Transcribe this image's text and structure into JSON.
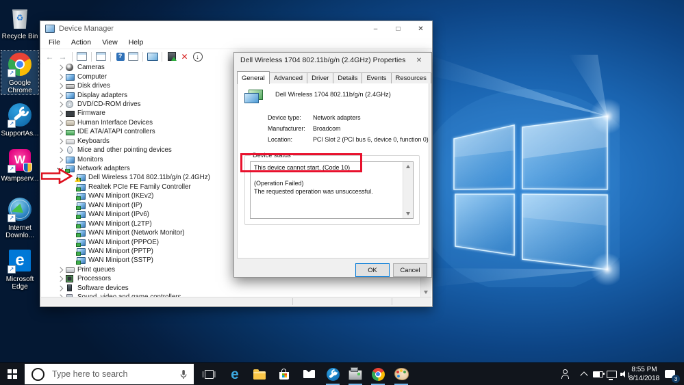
{
  "desktop": {
    "icons": [
      {
        "name": "recycle-bin",
        "lines": [
          "Recycle Bin"
        ]
      },
      {
        "name": "google-chrome",
        "lines": [
          "Google",
          "Chrome"
        ],
        "selected": true
      },
      {
        "name": "supportassist",
        "lines": [
          "SupportAs..."
        ]
      },
      {
        "name": "wampserver",
        "lines": [
          "Wampserv..."
        ]
      },
      {
        "name": "internet-download-manager",
        "lines": [
          "Internet",
          "Downlo..."
        ]
      },
      {
        "name": "microsoft-edge",
        "lines": [
          "Microsoft",
          "Edge"
        ]
      }
    ]
  },
  "device_manager": {
    "title": "Device Manager",
    "window_buttons": {
      "minimize": "–",
      "maximize": "□",
      "close": "✕"
    },
    "menu_items": [
      "File",
      "Action",
      "View",
      "Help"
    ],
    "toolbar": [
      "back",
      "forward",
      "sep",
      "console-tree",
      "sep",
      "properties",
      "sep",
      "help",
      "action-pane",
      "sep",
      "scan-hardware",
      "sep",
      "update-driver",
      "uninstall-device",
      "disable-device"
    ],
    "tree": [
      {
        "label": "Cameras",
        "icon": "camera",
        "expand": "collapsed"
      },
      {
        "label": "Computer",
        "icon": "computer",
        "expand": "collapsed"
      },
      {
        "label": "Disk drives",
        "icon": "disk",
        "expand": "collapsed"
      },
      {
        "label": "Display adapters",
        "icon": "display",
        "expand": "collapsed"
      },
      {
        "label": "DVD/CD-ROM drives",
        "icon": "dvd",
        "expand": "collapsed"
      },
      {
        "label": "Firmware",
        "icon": "firmware",
        "expand": "collapsed"
      },
      {
        "label": "Human Interface Devices",
        "icon": "hid",
        "expand": "collapsed"
      },
      {
        "label": "IDE ATA/ATAPI controllers",
        "icon": "ide",
        "expand": "collapsed"
      },
      {
        "label": "Keyboards",
        "icon": "keyboard",
        "expand": "collapsed"
      },
      {
        "label": "Mice and other pointing devices",
        "icon": "mouse",
        "expand": "collapsed"
      },
      {
        "label": "Monitors",
        "icon": "monitor",
        "expand": "collapsed"
      },
      {
        "label": "Network adapters",
        "icon": "network",
        "expand": "expanded"
      },
      {
        "label": "Dell Wireless 1704 802.11b/g/n (2.4GHz)",
        "icon": "network",
        "child": true,
        "warning": true
      },
      {
        "label": "Realtek PCIe FE Family Controller",
        "icon": "network",
        "child": true
      },
      {
        "label": "WAN Miniport (IKEv2)",
        "icon": "network",
        "child": true
      },
      {
        "label": "WAN Miniport (IP)",
        "icon": "network",
        "child": true
      },
      {
        "label": "WAN Miniport (IPv6)",
        "icon": "network",
        "child": true
      },
      {
        "label": "WAN Miniport (L2TP)",
        "icon": "network",
        "child": true
      },
      {
        "label": "WAN Miniport (Network Monitor)",
        "icon": "network",
        "child": true
      },
      {
        "label": "WAN Miniport (PPPOE)",
        "icon": "network",
        "child": true
      },
      {
        "label": "WAN Miniport (PPTP)",
        "icon": "network",
        "child": true
      },
      {
        "label": "WAN Miniport (SSTP)",
        "icon": "network",
        "child": true
      },
      {
        "label": "Print queues",
        "icon": "printer",
        "expand": "collapsed"
      },
      {
        "label": "Processors",
        "icon": "processor",
        "expand": "collapsed"
      },
      {
        "label": "Software devices",
        "icon": "software",
        "expand": "collapsed"
      },
      {
        "label": "Sound, video and game controllers",
        "icon": "sound",
        "expand": "collapsed"
      }
    ]
  },
  "properties_dialog": {
    "title": "Dell Wireless 1704 802.11b/g/n (2.4GHz) Properties",
    "close_glyph": "✕",
    "tabs": [
      {
        "label": "General",
        "active": true
      },
      {
        "label": "Advanced"
      },
      {
        "label": "Driver"
      },
      {
        "label": "Details"
      },
      {
        "label": "Events"
      },
      {
        "label": "Resources"
      }
    ],
    "device_name": "Dell Wireless 1704 802.11b/g/n (2.4GHz)",
    "fields": [
      {
        "label": "Device type:",
        "value": "Network adapters"
      },
      {
        "label": "Manufacturer:",
        "value": "Broadcom"
      },
      {
        "label": "Location:",
        "value": "PCI Slot 2 (PCI bus 6, device 0, function 0)"
      }
    ],
    "group_label": "Device status",
    "status_lines": [
      "This device cannot start. (Code 10)",
      "",
      "(Operation Failed)",
      "The requested operation was unsuccessful."
    ],
    "buttons": {
      "ok": "OK",
      "cancel": "Cancel"
    }
  },
  "taskbar": {
    "search_placeholder": "Type here to search",
    "apps": [
      {
        "name": "task-view"
      },
      {
        "name": "edge"
      },
      {
        "name": "file-explorer"
      },
      {
        "name": "store"
      },
      {
        "name": "mail"
      },
      {
        "name": "supportassist",
        "running": true
      },
      {
        "name": "device-manager",
        "running": true
      },
      {
        "name": "chrome",
        "running": true
      },
      {
        "name": "paint",
        "running": true
      }
    ],
    "tray": {
      "icons": [
        "people-icon",
        "chevron-up-icon",
        "battery-icon",
        "network-icon",
        "volume-icon"
      ],
      "time": "8:55 PM",
      "date": "8/14/2018",
      "notification_count": "3"
    }
  },
  "annotations": {
    "highlight_color": "#e8112d"
  }
}
